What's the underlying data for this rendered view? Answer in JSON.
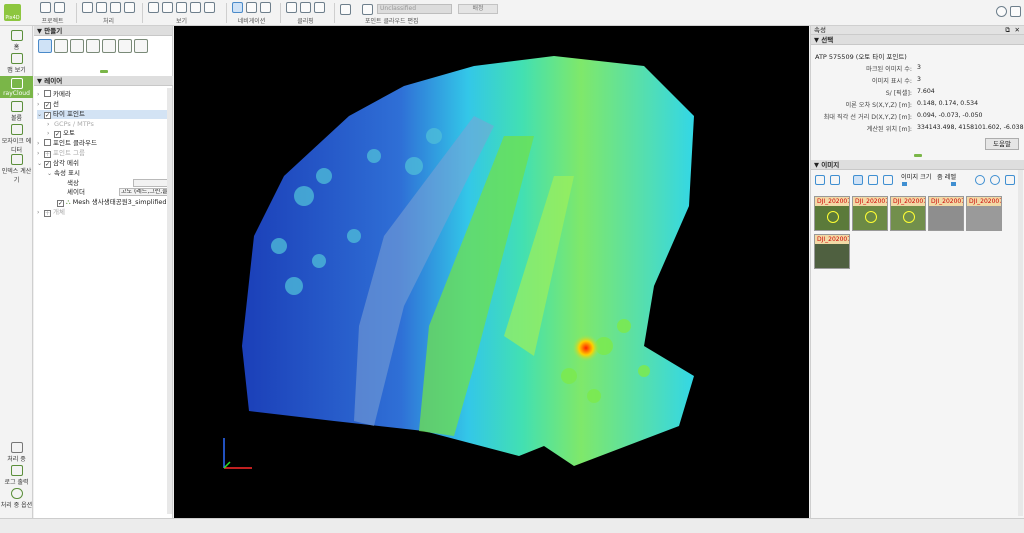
{
  "toolbar": {
    "logo_text": "Pix4D",
    "groups": [
      {
        "label": "프로젝트",
        "icons": [
          "globe-icon",
          "target-icon"
        ]
      },
      {
        "label": "처리",
        "icons": [
          "file-new-icon",
          "file-icon",
          "copy-icon",
          "reload-icon"
        ]
      },
      {
        "label": "보기",
        "icons": [
          "zoom-in-icon",
          "zoom-out-icon",
          "fit-view-icon",
          "fullscreen-icon",
          "axes-icon"
        ]
      },
      {
        "label": "네비게이션",
        "icons": [
          "move-icon",
          "rotate-icon",
          "pan-icon"
        ]
      },
      {
        "label": "클리핑",
        "icons": [
          "box-icon",
          "sphere-icon",
          "brush-icon"
        ]
      }
    ],
    "editing_label": "포인트 클라우드 편집",
    "class_combo": "Unclassified",
    "assign_button": "배정"
  },
  "leftnav": {
    "items": [
      {
        "label": "홈",
        "icon": "home-icon"
      },
      {
        "label": "맵 보기",
        "icon": "map-icon"
      },
      {
        "label": "rayCloud",
        "icon": "raycloud-icon"
      },
      {
        "label": "볼륨",
        "icon": "volume-icon"
      },
      {
        "label": "모자이크 에디터",
        "icon": "mosaic-icon"
      },
      {
        "label": "인덱스 계산기",
        "icon": "index-icon"
      }
    ],
    "bottom": [
      {
        "label": "처리 중",
        "icon": "processing-icon"
      },
      {
        "label": "로그 출력",
        "icon": "log-icon"
      },
      {
        "label": "처리 중 옵션",
        "icon": "gear-icon"
      }
    ]
  },
  "left_panel": {
    "create_title": "만들기",
    "layers_title": "레이어",
    "tree": [
      {
        "label": "카메라",
        "checked": false
      },
      {
        "label": "선",
        "checked": true
      },
      {
        "label": "타이 포인트",
        "checked": true
      },
      {
        "label": "GCPs / MTPs",
        "muted": true
      },
      {
        "label": "오토",
        "checked": true
      },
      {
        "label": "포인트 클라우드",
        "checked": false
      },
      {
        "label": "포인트 그룹",
        "muted": true
      },
      {
        "label": "삼각 메쉬",
        "checked": true
      },
      {
        "label": "속성 표시"
      },
      {
        "label": "색상"
      },
      {
        "label": "셰이더"
      },
      {
        "label": "Mesh 생사생태공원3_simplified",
        "checked": true
      },
      {
        "label": "개체",
        "muted": true
      }
    ],
    "color_value": "",
    "shader_value": "고도 (레드,그린,블루)"
  },
  "right_panel": {
    "title": "속성",
    "selection_title": "선택",
    "atp_name": "ATP 575509 (오토 타이 포인트)",
    "props": [
      {
        "key": "마크된 이미지 수:",
        "value": "3"
      },
      {
        "key": "이미지 표시 수:",
        "value": "3"
      },
      {
        "key": "S/ [픽셀]:",
        "value": "7.604"
      },
      {
        "key": "이론 오차 S(X,Y,Z) [m]:",
        "value": "0.148, 0.174, 0.534"
      },
      {
        "key": "최대 직각 선 거리 D(X,Y,Z) [m]:",
        "value": "0.094, -0.073, -0.050"
      },
      {
        "key": "계산된 위치 [m]:",
        "value": "334143.498, 4158101.602, -6.038"
      }
    ],
    "help_button": "도움말",
    "images_title": "이미지",
    "image_size_label": "이미지 크기",
    "zoom_label": "줌 레벨",
    "thumbnails": [
      {
        "label": "DJI_202007"
      },
      {
        "label": "DJI_202007"
      },
      {
        "label": "DJI_202007"
      },
      {
        "label": "DJI_202007"
      },
      {
        "label": "DJI_202007"
      },
      {
        "label": "DJI_202007"
      }
    ]
  },
  "colors": {
    "accent": "#7ab648",
    "selection": "#cfe2f6",
    "viewport_bg": "#000000"
  }
}
